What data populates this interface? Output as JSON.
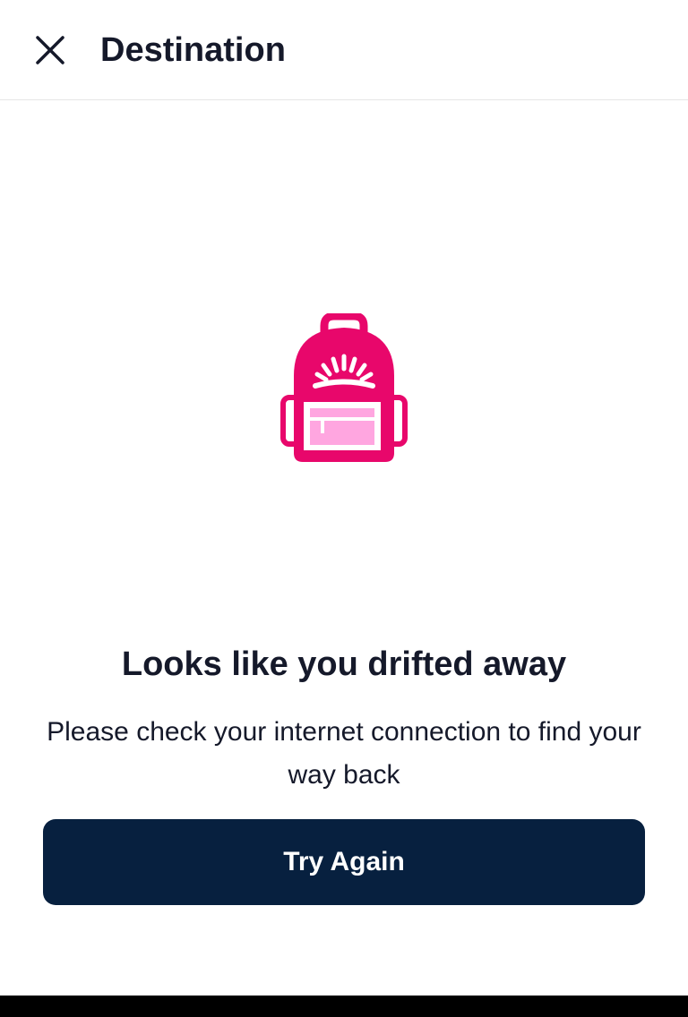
{
  "header": {
    "title": "Destination",
    "close_icon": "close-icon"
  },
  "illustration": {
    "icon": "backpack-icon",
    "primary_color": "#e8076b",
    "pocket_color": "#ffa6e0"
  },
  "main": {
    "headline": "Looks like you drifted away",
    "message": "Please check your internet connection to find your way back",
    "retry_label": "Try Again"
  },
  "colors": {
    "button_bg": "#07203f",
    "text": "#15192a",
    "accent": "#e8076b"
  }
}
